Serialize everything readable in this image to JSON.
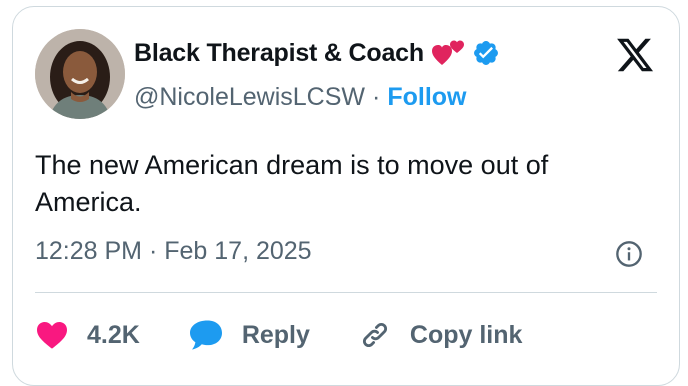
{
  "author": {
    "display_name": "Black Therapist & Coach",
    "handle": "@NicoleLewisLCSW",
    "separator": "·",
    "follow_label": "Follow"
  },
  "tweet": {
    "text": "The new American dream is to move out of America.",
    "time": "12:28 PM",
    "separator": "·",
    "date": "Feb 17, 2025"
  },
  "actions": {
    "like_count": "4.2K",
    "reply_label": "Reply",
    "copy_link_label": "Copy link"
  },
  "icons": {
    "logo": "x-logo-icon",
    "verified": "verified-badge-icon",
    "hearts": "two-hearts-emoji-icon",
    "info": "info-icon",
    "like": "heart-icon",
    "reply": "speech-bubble-icon",
    "copy_link": "link-icon"
  },
  "colors": {
    "accent": "#1d9bf0",
    "like": "#f91880",
    "text": "#0f1419",
    "secondary": "#536471",
    "border": "#cfd9de"
  }
}
